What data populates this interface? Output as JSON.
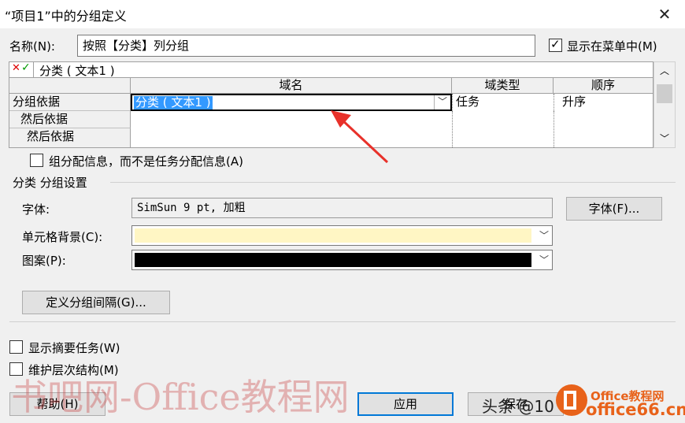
{
  "window": {
    "title": "“项目1”中的分组定义",
    "close_glyph": "✕"
  },
  "name_field": {
    "label": "名称(N):",
    "value": "按照【分类】列分组"
  },
  "show_in_menu": {
    "label": "显示在菜单中(M)",
    "checked": true
  },
  "grid": {
    "edit_cancel_icon": "✕",
    "edit_confirm_icon": "✓",
    "edit_value": "分类 ( 文本1 )",
    "columns": [
      "域名",
      "域类型",
      "顺序"
    ],
    "rows": [
      {
        "header": "分组依据",
        "field": "分类 ( 文本1 )",
        "field_type": "任务",
        "order": "升序"
      },
      {
        "header": "然后依据",
        "field": "",
        "field_type": "",
        "order": ""
      },
      {
        "header": "然后依据",
        "field": "",
        "field_type": "",
        "order": ""
      }
    ]
  },
  "group_assignments": {
    "label": "组分配信息，而不是任务分配信息(A)",
    "checked": false
  },
  "group_settings": {
    "title": "分类 分组设置",
    "font_label": "字体:",
    "font_value": "SimSun 9 pt, 加粗",
    "font_button": "字体(F)...",
    "cell_bg_label": "单元格背景(C):",
    "cell_bg_color": "#fff6c4",
    "pattern_label": "图案(P):",
    "pattern_color": "#000000",
    "define_intervals_button": "定义分组间隔(G)..."
  },
  "show_summary": {
    "label": "显示摘要任务(W)",
    "checked": false
  },
  "maintain_hierarchy": {
    "label": "维护层次结构(M)",
    "checked": false
  },
  "buttons": {
    "help": "帮助(H)",
    "apply": "应用",
    "save": "保存"
  },
  "watermarks": {
    "left": "书吧网-Office教程网",
    "toutiao": "头条 @10",
    "office_line1": "Office教程网",
    "office_line2": "office66.cn"
  },
  "colors": {
    "accent": "#0078d7",
    "selection": "#3399ff",
    "arrow": "#e8312a",
    "office_orange": "#e8621a"
  }
}
